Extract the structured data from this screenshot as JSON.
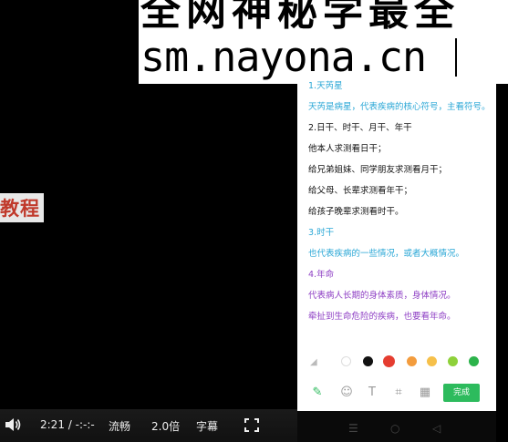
{
  "watermark": {
    "line1": "全网神秘学最全",
    "line2": "sm.nayona.cn"
  },
  "side_text": "教程",
  "notes": [
    {
      "text": "1.天芮星",
      "style": "head-teal"
    },
    {
      "text": "天芮是病星，代表疾病的核心符号，主看符号。",
      "style": "teal"
    },
    {
      "text": "2.日干、时干、月干、年干",
      "style": "black"
    },
    {
      "text": "他本人求测看日干；",
      "style": "black"
    },
    {
      "text": "给兄弟姐妹、同学朋友求测看月干；",
      "style": "black"
    },
    {
      "text": "给父母、长辈求测看年干；",
      "style": "black"
    },
    {
      "text": "给孩子晚辈求测看时干。",
      "style": "black"
    },
    {
      "text": "3.时干",
      "style": "head-teal"
    },
    {
      "text": "也代表疾病的一些情况，或者大概情况。",
      "style": "teal"
    },
    {
      "text": "4.年命",
      "style": "head-purple"
    },
    {
      "text": "代表病人长期的身体素质，身体情况。",
      "style": "purple"
    },
    {
      "text": "牵扯到生命危险的疾病，也要看年命。",
      "style": "purple"
    }
  ],
  "palette": {
    "colors": [
      "#ffffff",
      "#111111",
      "#e53d30",
      "#f39c3d",
      "#f6c04a",
      "#8ed13a",
      "#2cb34b"
    ],
    "selected": "#e53d30"
  },
  "tools": {
    "icons": [
      "pencil-icon",
      "emoji-icon",
      "text-icon",
      "crop-icon",
      "mosaic-icon"
    ],
    "done_label": "完成"
  },
  "player": {
    "time": "2:21 / -:-:-",
    "quality": "流畅",
    "speed": "2.0倍",
    "subtitle": "字幕"
  }
}
